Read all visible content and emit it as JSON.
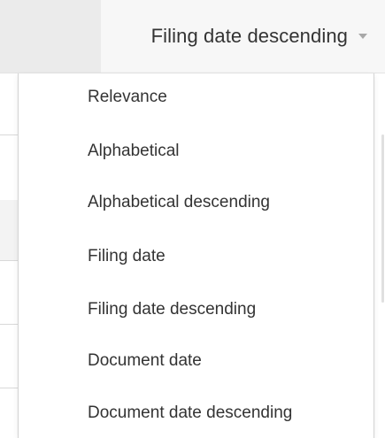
{
  "sort": {
    "selected_label": "Filing date descending",
    "chevron_icon": "chevron-down-icon"
  },
  "dropdown": {
    "items": [
      {
        "label": "Relevance"
      },
      {
        "label": "Alphabetical"
      },
      {
        "label": "Alphabetical descending"
      },
      {
        "label": "Filing date"
      },
      {
        "label": "Filing date descending"
      },
      {
        "label": "Document date"
      },
      {
        "label": "Document date descending"
      }
    ]
  },
  "colors": {
    "text": "#333333",
    "top_bar_bg": "#f7f7f7",
    "chevron": "#a8a8a8",
    "border": "#d4d4d4"
  }
}
